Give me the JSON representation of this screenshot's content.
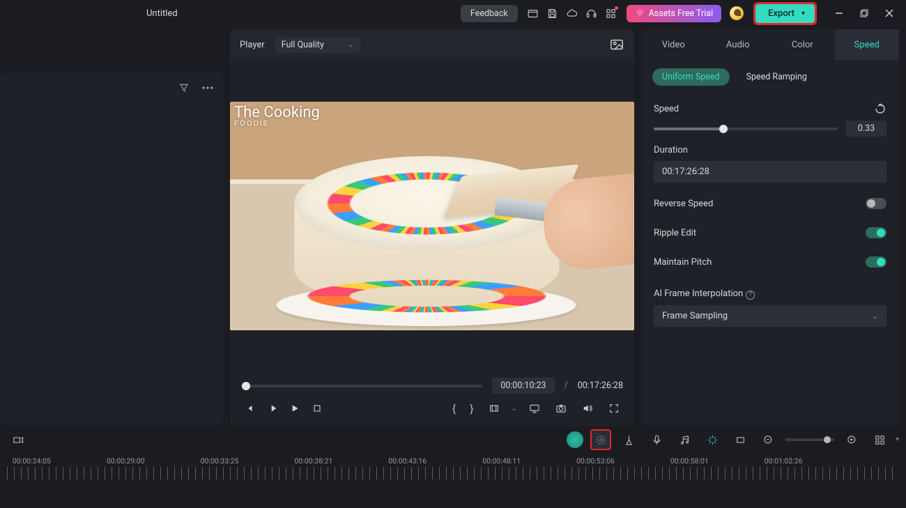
{
  "title": "Untitled",
  "titlebar": {
    "feedback": "Feedback",
    "assets_trial": "Assets Free Trial",
    "export": "Export"
  },
  "player": {
    "label": "Player",
    "quality": "Full Quality",
    "current_time": "00:00:10:23",
    "total_time": "00:17:26:28",
    "seek_percent": 2
  },
  "preview_logo": {
    "line1": "The",
    "line2": "Cooking",
    "line3": "FOODIE"
  },
  "panel": {
    "tabs": [
      "Video",
      "Audio",
      "Color",
      "Speed"
    ],
    "active_tab": 3,
    "sub_tabs": [
      "Uniform Speed",
      "Speed Ramping"
    ],
    "active_sub": 0,
    "speed_label": "Speed",
    "speed_value": "0.33",
    "speed_percent": 38,
    "duration_label": "Duration",
    "duration_value": "00:17:26:28",
    "reverse_label": "Reverse Speed",
    "reverse_on": false,
    "ripple_label": "Ripple Edit",
    "ripple_on": true,
    "pitch_label": "Maintain Pitch",
    "pitch_on": true,
    "interp_label": "AI Frame Interpolation",
    "interp_value": "Frame Sampling"
  },
  "timeline": {
    "zoom_percent": 85,
    "marks": [
      "00:00:24:05",
      "00:00:29:00",
      "00:00:33:25",
      "00:00:38:21",
      "00:00:43:16",
      "00:00:48:11",
      "00:00:53:06",
      "00:00:58:01",
      "00:01:02:26"
    ]
  }
}
